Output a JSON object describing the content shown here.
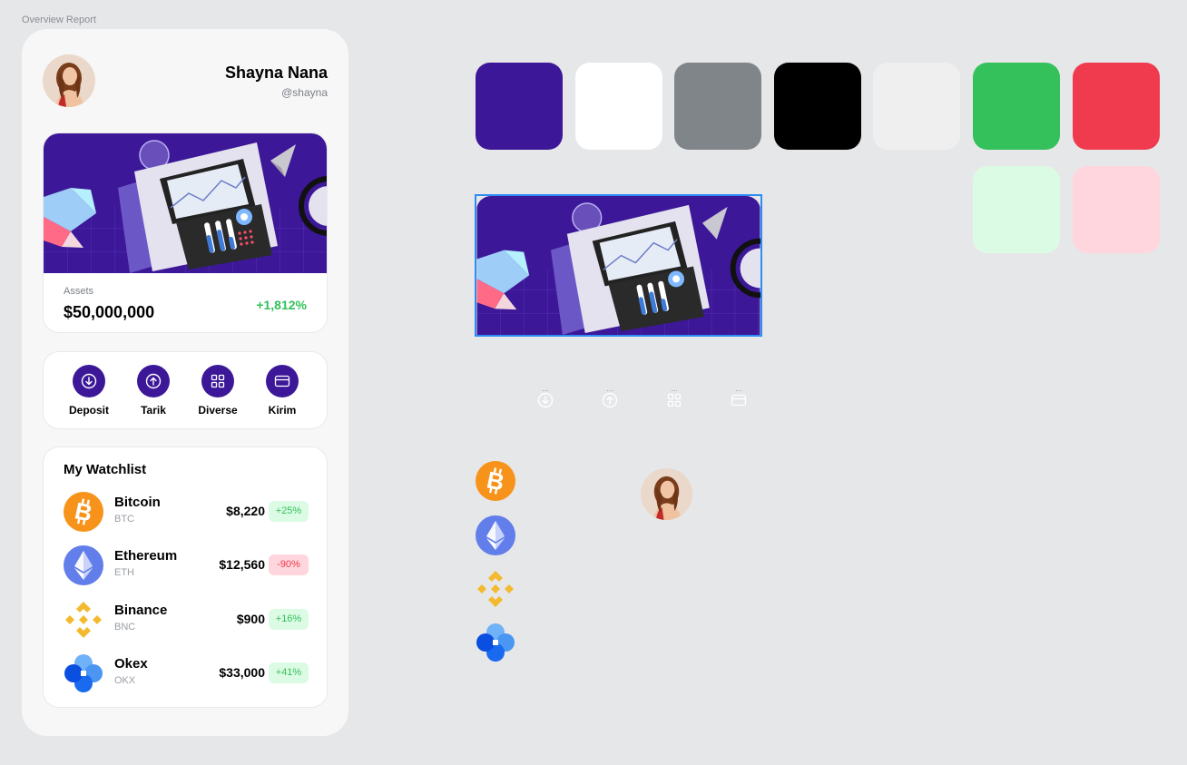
{
  "frame": {
    "label": "Overview Report"
  },
  "profile": {
    "name": "Shayna Nana",
    "handle": "@shayna"
  },
  "assets": {
    "label": "Assets",
    "value": "$50,000,000",
    "change": "+1,812%"
  },
  "actions": [
    {
      "label": "Deposit",
      "icon": "arrow-down-circle-icon"
    },
    {
      "label": "Tarik",
      "icon": "arrow-up-circle-icon"
    },
    {
      "label": "Diverse",
      "icon": "grid-icon"
    },
    {
      "label": "Kirim",
      "icon": "card-icon"
    }
  ],
  "watchlist": {
    "title": "My Watchlist",
    "items": [
      {
        "name": "Bitcoin",
        "symbol": "BTC",
        "price": "$8,220",
        "change": "+25%",
        "trend": "up",
        "icon": "bitcoin-icon"
      },
      {
        "name": "Ethereum",
        "symbol": "ETH",
        "price": "$12,560",
        "change": "-90%",
        "trend": "down",
        "icon": "ethereum-icon"
      },
      {
        "name": "Binance",
        "symbol": "BNC",
        "price": "$900",
        "change": "+16%",
        "trend": "up",
        "icon": "binance-icon"
      },
      {
        "name": "Okex",
        "symbol": "OKX",
        "price": "$33,000",
        "change": "+41%",
        "trend": "up",
        "icon": "okex-icon"
      }
    ]
  },
  "palette": [
    {
      "name": "primary",
      "color": "#3c1898"
    },
    {
      "name": "white",
      "color": "#ffffff"
    },
    {
      "name": "gray",
      "color": "#80858a"
    },
    {
      "name": "black",
      "color": "#000000"
    },
    {
      "name": "light",
      "color": "#efefef"
    },
    {
      "name": "success",
      "color": "#34c15b"
    },
    {
      "name": "danger",
      "color": "#ef3b4d"
    },
    {
      "name": "success-light",
      "color": "#dcfbe4"
    },
    {
      "name": "danger-light",
      "color": "#ffd6dd"
    }
  ],
  "spec_icons": {
    "dots": "..."
  }
}
